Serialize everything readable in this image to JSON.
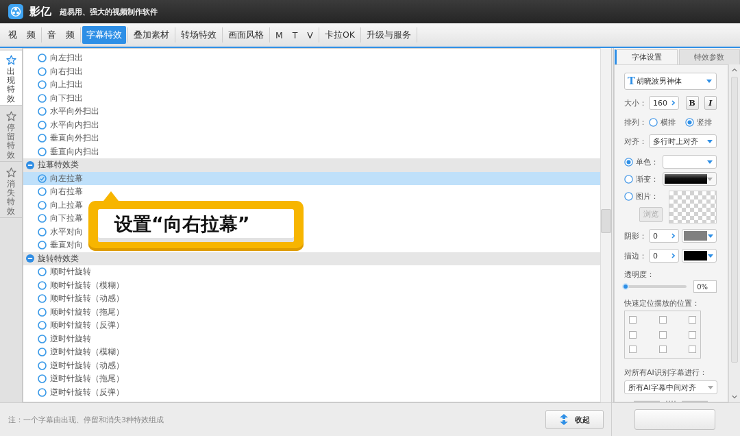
{
  "window": {
    "app_name": "影亿",
    "tagline": "超易用、强大的视频制作软件"
  },
  "menu_tabs": [
    {
      "label": "视 频",
      "selected": false
    },
    {
      "label": "音 频",
      "selected": false
    },
    {
      "label": "字幕特效",
      "selected": true
    },
    {
      "label": "叠加素材",
      "selected": false
    },
    {
      "label": "转场特效",
      "selected": false
    },
    {
      "label": "画面风格",
      "selected": false
    },
    {
      "label": "M T V",
      "selected": false
    },
    {
      "label": "卡拉OK",
      "selected": false
    },
    {
      "label": "升级与服务",
      "selected": false
    }
  ],
  "side_tabs": [
    {
      "label": "出现特效",
      "selected": true
    },
    {
      "label": "停留特效",
      "selected": false
    },
    {
      "label": "消失特效",
      "selected": false
    }
  ],
  "effect_groups": [
    {
      "children": [
        {
          "label": "向左扫出",
          "selected": false
        },
        {
          "label": "向右扫出",
          "selected": false
        },
        {
          "label": "向上扫出",
          "selected": false
        },
        {
          "label": "向下扫出",
          "selected": false
        },
        {
          "label": "水平向外扫出",
          "selected": false
        },
        {
          "label": "水平向内扫出",
          "selected": false
        },
        {
          "label": "垂直向外扫出",
          "selected": false
        },
        {
          "label": "垂直向内扫出",
          "selected": false
        }
      ]
    },
    {
      "title": "拉幕特效类",
      "expanded": true,
      "children": [
        {
          "label": "向左拉幕",
          "selected": true
        },
        {
          "label": "向右拉幕",
          "selected": false
        },
        {
          "label": "向上拉幕",
          "selected": false
        },
        {
          "label": "向下拉幕",
          "selected": false
        },
        {
          "label": "水平对向",
          "selected": false
        },
        {
          "label": "垂直对向",
          "selected": false
        }
      ]
    },
    {
      "title": "旋转特效类",
      "expanded": true,
      "children": [
        {
          "label": "顺时针旋转",
          "selected": false
        },
        {
          "label": "顺时针旋转（模糊）",
          "selected": false
        },
        {
          "label": "顺时针旋转（动感）",
          "selected": false
        },
        {
          "label": "顺时针旋转（拖尾）",
          "selected": false
        },
        {
          "label": "顺时针旋转（反弹）",
          "selected": false
        },
        {
          "label": "逆时针旋转",
          "selected": false
        },
        {
          "label": "逆时针旋转（模糊）",
          "selected": false
        },
        {
          "label": "逆时针旋转（动感）",
          "selected": false
        },
        {
          "label": "逆时针旋转（拖尾）",
          "selected": false
        },
        {
          "label": "逆时针旋转（反弹）",
          "selected": false
        }
      ]
    }
  ],
  "callout": {
    "text": "设置“向右拉幕”"
  },
  "panel_tabs": [
    {
      "label": "字体设置",
      "selected": true
    },
    {
      "label": "特效参数",
      "selected": false
    }
  ],
  "font": {
    "icon": "T",
    "value": "胡晓波男神体"
  },
  "size": {
    "label": "大小：",
    "value": "160"
  },
  "style_buttons": [
    {
      "kind": "bold",
      "label": "B"
    },
    {
      "kind": "italic",
      "label": "I"
    }
  ],
  "arrangement": {
    "label": "排列：",
    "options": [
      {
        "label": "横排",
        "selected": false
      },
      {
        "label": "竖排",
        "selected": true
      }
    ]
  },
  "align": {
    "label": "对齐：",
    "value": "多行时上对齐"
  },
  "fill_modes": [
    {
      "kind": "solid",
      "label": "单色：",
      "selected": true
    },
    {
      "kind": "gradient",
      "label": "渐变：",
      "selected": false
    },
    {
      "kind": "image",
      "label": "图片：",
      "selected": false,
      "button": "浏览"
    }
  ],
  "shadow": {
    "label": "阴影：",
    "value": "0",
    "color": "#808080"
  },
  "stroke": {
    "label": "描边：",
    "value": "0",
    "color": "#000000"
  },
  "opacity": {
    "label": "透明度：",
    "level": 0,
    "value": "0%"
  },
  "position": {
    "label": "快速定位摆放的位置：",
    "cells": [
      {
        "checked": false
      },
      {
        "checked": false
      },
      {
        "checked": false
      },
      {
        "checked": false
      },
      {
        "checked": false
      },
      {
        "checked": false
      },
      {
        "checked": false
      },
      {
        "checked": false
      },
      {
        "checked": false
      }
    ]
  },
  "ai_align": {
    "label": "对所有AI识别字幕进行：",
    "value": "所有AI字幕中间对齐"
  },
  "footer": {
    "note": "注：一个字幕由出现、停留和消失3种特效组成",
    "collapse_button": "收起"
  }
}
